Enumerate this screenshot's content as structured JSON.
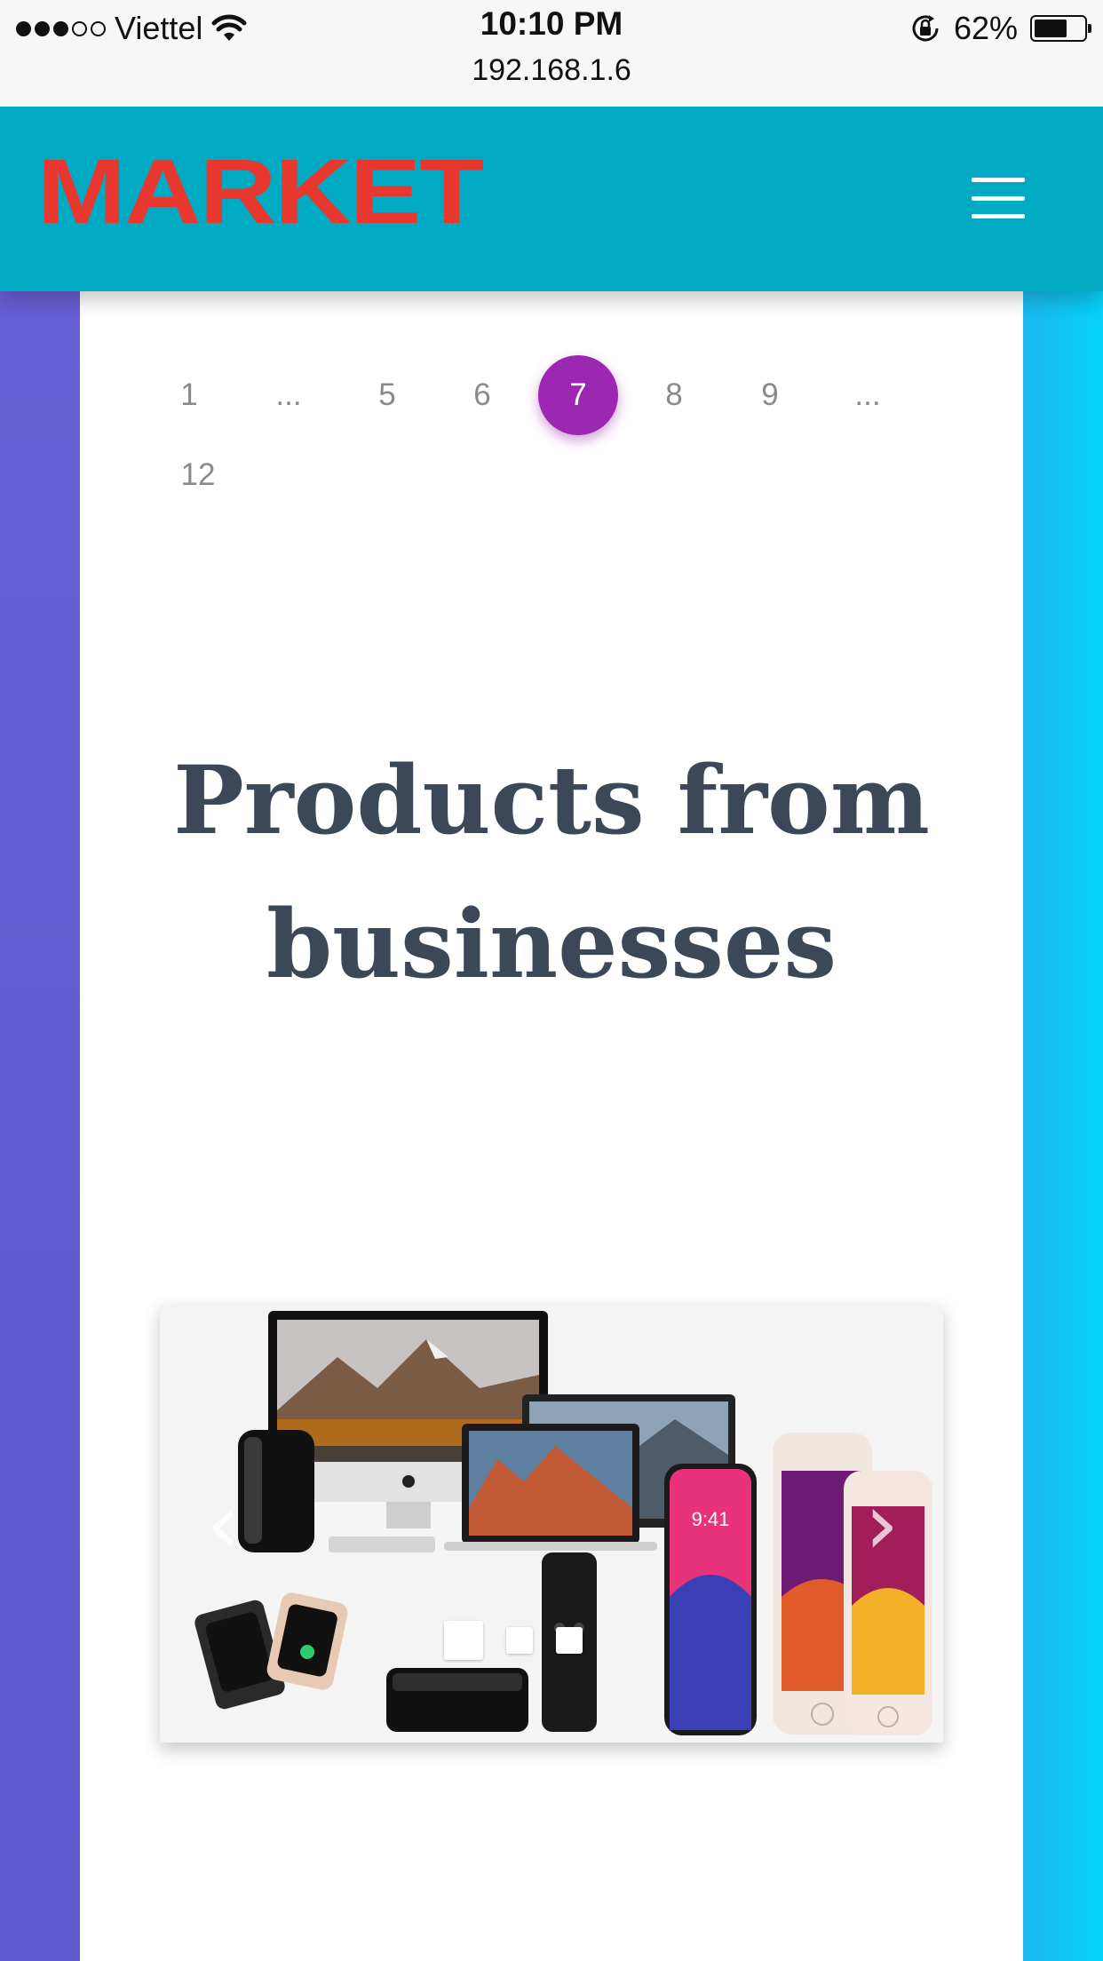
{
  "status_bar": {
    "carrier": "Viettel",
    "time": "10:10 PM",
    "url": "192.168.1.6",
    "battery": "62%",
    "battery_level": 0.62
  },
  "header": {
    "logo": "MARKET",
    "menu_icon": "hamburger-icon"
  },
  "pagination": {
    "pages": [
      "1",
      "...",
      "5",
      "6",
      "7",
      "8",
      "9",
      "...",
      "12"
    ],
    "active": "7"
  },
  "section": {
    "title": "Products from businesses"
  },
  "carousel": {
    "slide_count": 3,
    "active_slide": 1,
    "prev_icon": "chevron-left-icon",
    "next_icon": "chevron-right-icon"
  },
  "colors": {
    "header_bg": "#00aac2",
    "logo": "#e8372f",
    "active_page": "#9c27b0",
    "title": "#3c4858"
  }
}
